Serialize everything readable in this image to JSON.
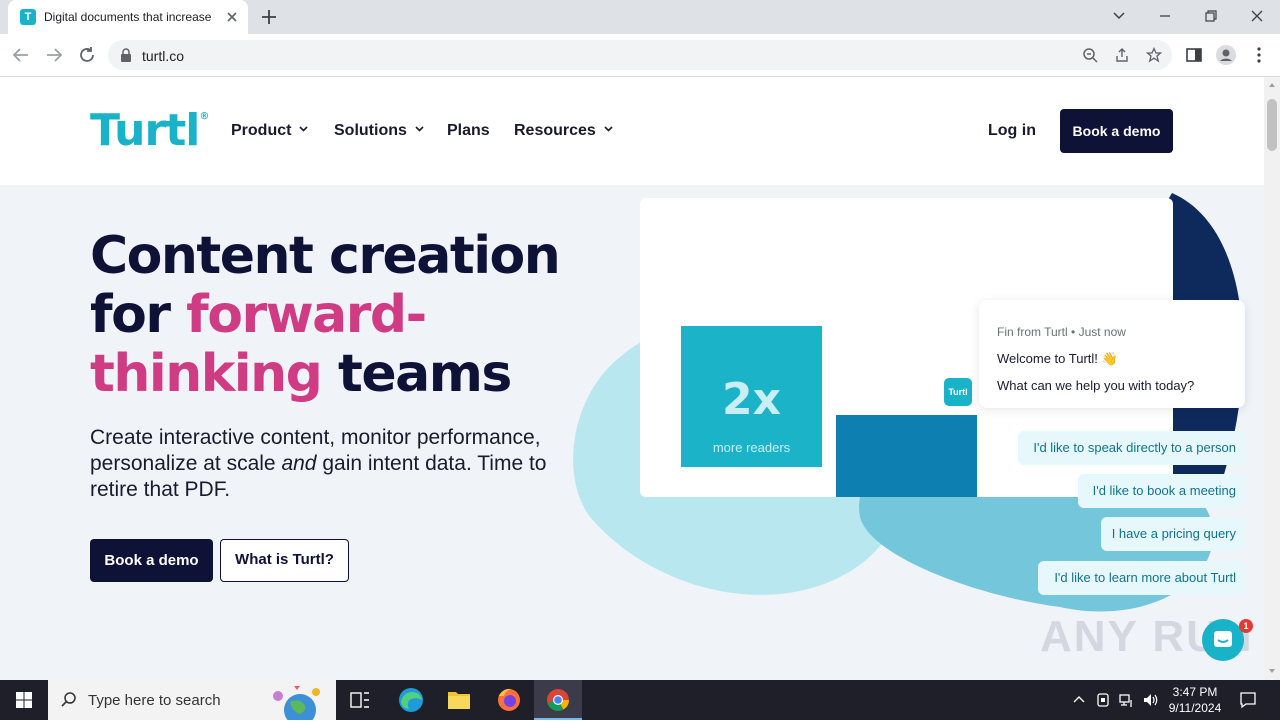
{
  "browser": {
    "tab_title": "Digital documents that increase",
    "tab_favicon_letter": "T",
    "url": "turtl.co"
  },
  "site": {
    "logo_text": "Turtl",
    "logo_mark": "®",
    "nav": [
      {
        "label": "Product",
        "has_dropdown": true
      },
      {
        "label": "Solutions",
        "has_dropdown": true
      },
      {
        "label": "Plans",
        "has_dropdown": false
      },
      {
        "label": "Resources",
        "has_dropdown": true
      }
    ],
    "login_label": "Log in",
    "header_cta": "Book a demo"
  },
  "hero": {
    "title_line1": "Content creation",
    "title_for": "for ",
    "title_pink1": "forward-",
    "title_pink2": "thinking",
    "title_teams": " teams",
    "subtitle_pre": "Create interactive content, monitor performance, personalize at scale ",
    "subtitle_em": "and",
    "subtitle_post": " gain intent data. Time to retire that PDF.",
    "cta_primary": "Book a demo",
    "cta_secondary": "What is Turtl?"
  },
  "showcase": {
    "stat_value": "2x",
    "stat_label": "more readers"
  },
  "chat": {
    "sender": "Fin from Turtl",
    "time": "Just now",
    "greeting": "Welcome to Turtl! 👋",
    "question": "What can we help you with today?",
    "avatar_text": "Turtl",
    "replies": [
      "I'd like to speak directly to a person",
      "I'd like to book a meeting",
      "I have a pricing query",
      "I'd like to learn more about Turtl"
    ],
    "unread_count": "1"
  },
  "watermark": "ANY RUN",
  "taskbar": {
    "search_placeholder": "Type here to search",
    "time": "3:47 PM",
    "date": "9/11/2024"
  },
  "colors": {
    "brand_teal": "#19b3c9",
    "brand_navy": "#0f1237",
    "brand_pink": "#d03c83",
    "deep_blue": "#0d7fb0"
  }
}
